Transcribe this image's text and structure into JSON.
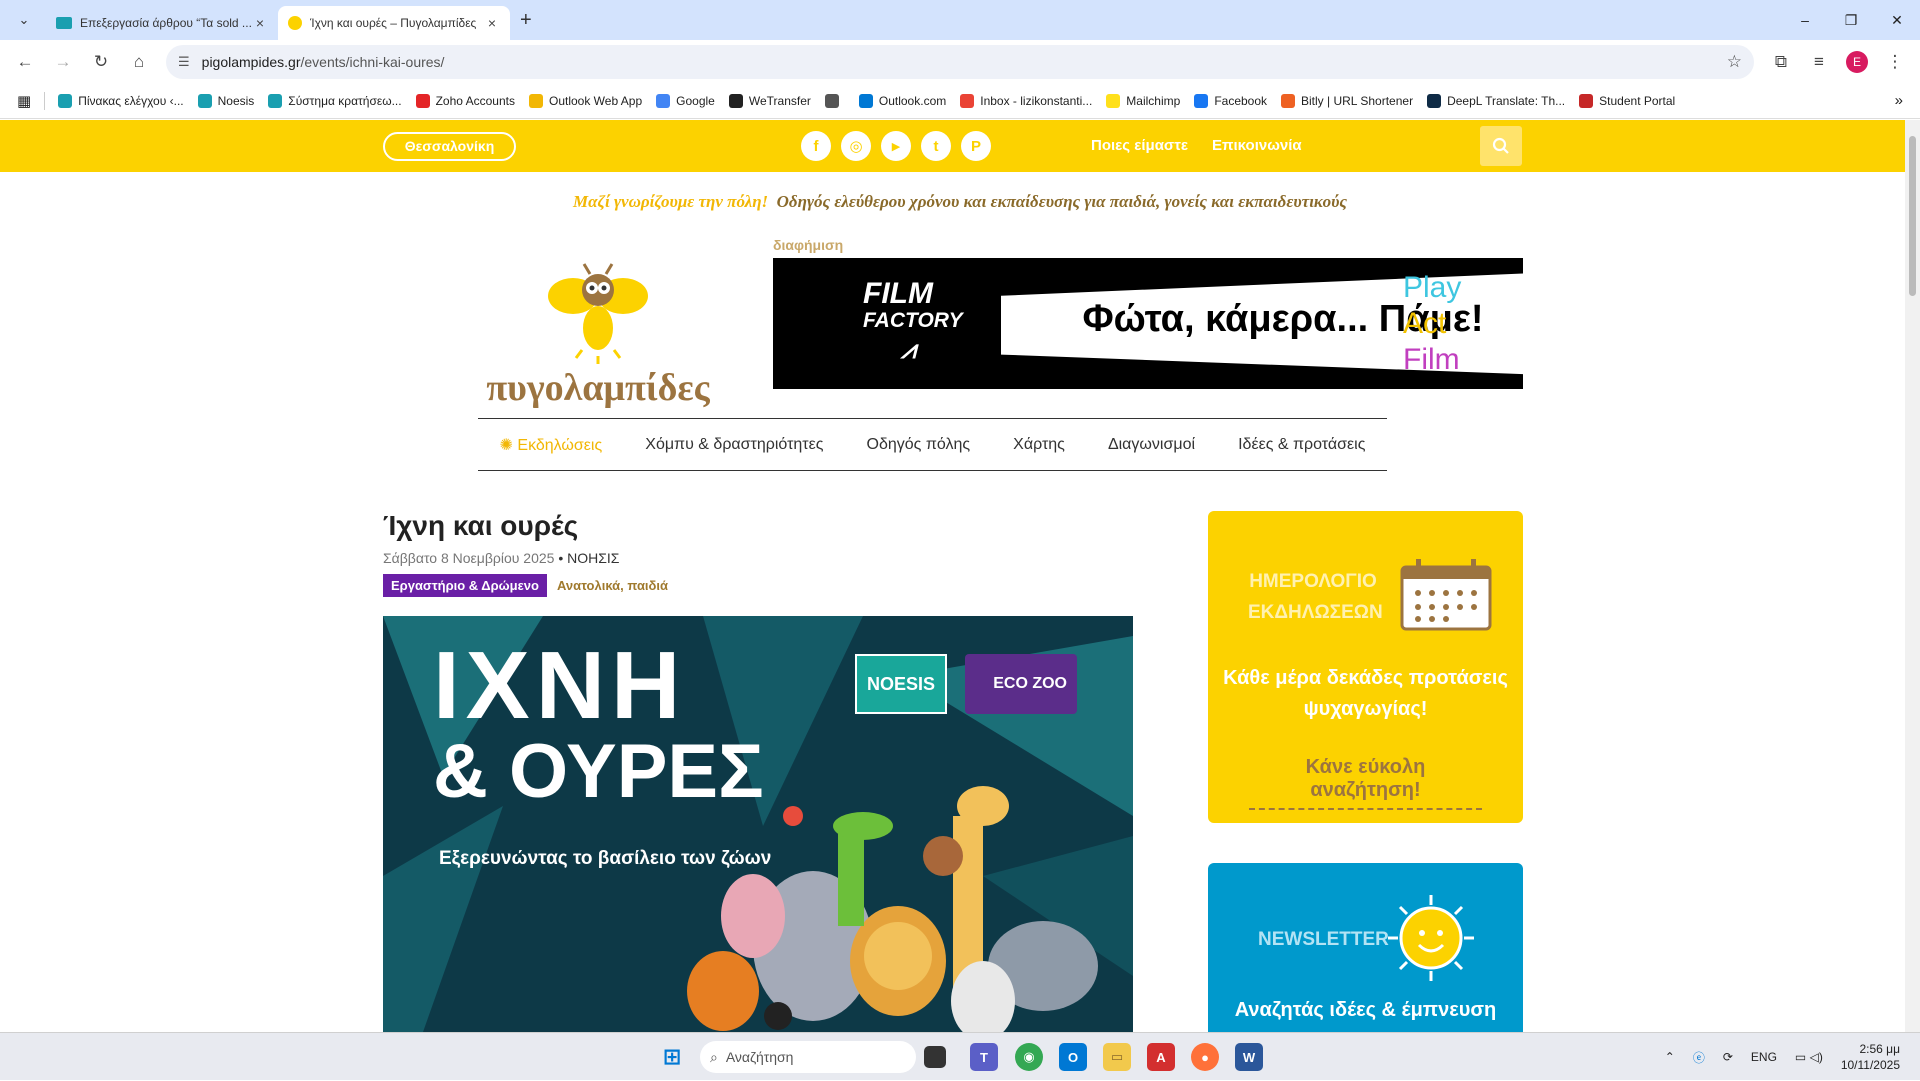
{
  "browser": {
    "tabs": [
      {
        "title": "Επεξεργασία άρθρου “Τα sold ...",
        "active": false
      },
      {
        "title": "Ίχνη και ουρές – Πυγολαμπίδες",
        "active": true
      }
    ],
    "url_host": "pigolampides.gr",
    "url_path": "/events/ichni-kai-oures/",
    "profile_initial": "E"
  },
  "bookmarks": [
    {
      "label": "Πίνακας ελέγχου ‹...",
      "color": "#1a9fb0"
    },
    {
      "label": "Noesis",
      "color": "#1a9fb0"
    },
    {
      "label": "Σύστημα κρατήσεω...",
      "color": "#1a9fb0"
    },
    {
      "label": "Zoho Accounts",
      "color": "#e42527"
    },
    {
      "label": "Outlook Web App",
      "color": "#f2b705"
    },
    {
      "label": "Google",
      "color": "#4285f4"
    },
    {
      "label": "WeTransfer",
      "color": "#222222"
    },
    {
      "label": "",
      "color": "#555555"
    },
    {
      "label": "Outlook.com",
      "color": "#0078d4"
    },
    {
      "label": "Inbox - lizikonstanti...",
      "color": "#ea4335"
    },
    {
      "label": "Mailchimp",
      "color": "#ffe01b"
    },
    {
      "label": "Facebook",
      "color": "#1877f2"
    },
    {
      "label": "Bitly | URL Shortener",
      "color": "#ee6123"
    },
    {
      "label": "DeepL Translate: Th...",
      "color": "#0f2b46"
    },
    {
      "label": "Student Portal",
      "color": "#c62828"
    }
  ],
  "site": {
    "city_button": "Θεσσαλονίκη",
    "top_links": [
      "Ποιες είμαστε",
      "Επικοινωνία"
    ],
    "socials": [
      "f",
      "◎",
      "▶",
      "t",
      "P"
    ],
    "tagline_a": "Μαζί γνωρίζουμε την πόλη!",
    "tagline_b": "Οδηγός ελεύθερου χρόνου και εκπαίδευσης για παιδιά, γονείς και εκπαιδευτικούς",
    "logo_text": "πυγολαμπίδες",
    "ad_label": "διαφήμιση",
    "banner": {
      "brand_1": "FILM",
      "brand_2": "FACTORY",
      "slogan": "Φώτα, κάμερα... Πάμε!",
      "play": "Play",
      "act": "Act",
      "film": "Film"
    },
    "nav": [
      "Εκδηλώσεις",
      "Χόμπυ & δραστηριότητες",
      "Οδηγός πόλης",
      "Χάρτης",
      "Διαγωνισμοί",
      "Ιδέες & προτάσεις"
    ]
  },
  "article": {
    "title": "Ίχνη και ουρές",
    "date": "Σάββατο 8 Νοεμβρίου 2025",
    "separator": "•",
    "organizer": "ΝΟΗΣΙΣ",
    "category": "Εργαστήριο & Δρώμενο",
    "tags_text": "Ανατολικά, παιδιά",
    "poster": {
      "title_1": "ΙΧΝΗ",
      "title_2": "& ΟΥΡΕΣ",
      "subtitle": "Εξερευνώντας το βασίλειο των ζώων",
      "logo_1": "NOESIS",
      "logo_2": "ECO ZOO"
    }
  },
  "sidebar": {
    "calendar_title": "ΗΜΕΡΟΛΟΓΙΟ ΕΚΔΗΛΩΣΕΩΝ",
    "calendar_text": "Κάθε μέρα δεκάδες προτάσεις ψυχαγωγίας!",
    "calendar_cta": "Κάνε εύκολη αναζήτηση!",
    "newsletter_title": "NEWSLETTER",
    "newsletter_text": "Αναζητάς ιδέες & έμπνευση"
  },
  "taskbar": {
    "search_placeholder": "Αναζήτηση",
    "language": "ENG",
    "time": "2:56 μμ",
    "date": "10/11/2025"
  },
  "colors": {
    "brand_yellow": "#fcd200",
    "brand_brown": "#9c7440",
    "category_purple": "#6a1fa6",
    "newsletter_blue": "#0099cc"
  }
}
